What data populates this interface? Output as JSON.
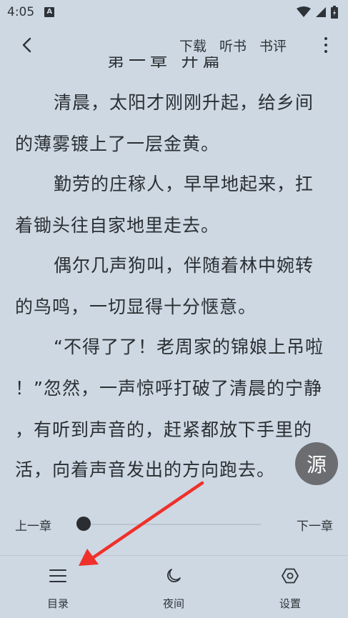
{
  "status_bar": {
    "time": "4:05",
    "app_badge": "A",
    "icons": [
      "wifi-icon",
      "signal-icon",
      "battery-icon"
    ]
  },
  "toolbar": {
    "back_icon": "chevron-left-icon",
    "actions": [
      "下载",
      "听书",
      "书评"
    ],
    "more_icon": "more-vertical-icon"
  },
  "chapter_title_partial": "第一章 开篇",
  "content_lines": [
    "清晨，太阳才刚刚升起，给乡间",
    "的薄雾镀上了一层金黄。",
    "勤劳的庄稼人，早早地起来，扛",
    "着锄头往自家地里走去。",
    "偶尔几声狗叫，伴随着林中婉转",
    "的鸟鸣，一切显得十分惬意。",
    "“不得了了！老周家的锦娘上吊啦",
    "！”忽然，一声惊呼打破了清晨的宁静",
    "，有听到声音的，赶紧都放下手里的",
    "活，向着声音发出的方向跑去。"
  ],
  "source_button": "源",
  "chapter_nav": {
    "prev": "上一章",
    "next": "下一章",
    "progress": 0
  },
  "bottom_menu": [
    {
      "label": "目录",
      "icon": "list-icon"
    },
    {
      "label": "夜间",
      "icon": "moon-icon"
    },
    {
      "label": "设置",
      "icon": "settings-icon"
    }
  ],
  "colors": {
    "background": "#cdd8e3",
    "text": "#2b2f33",
    "source_button": "#6b6d70",
    "annotation_arrow": "#f0302a"
  }
}
